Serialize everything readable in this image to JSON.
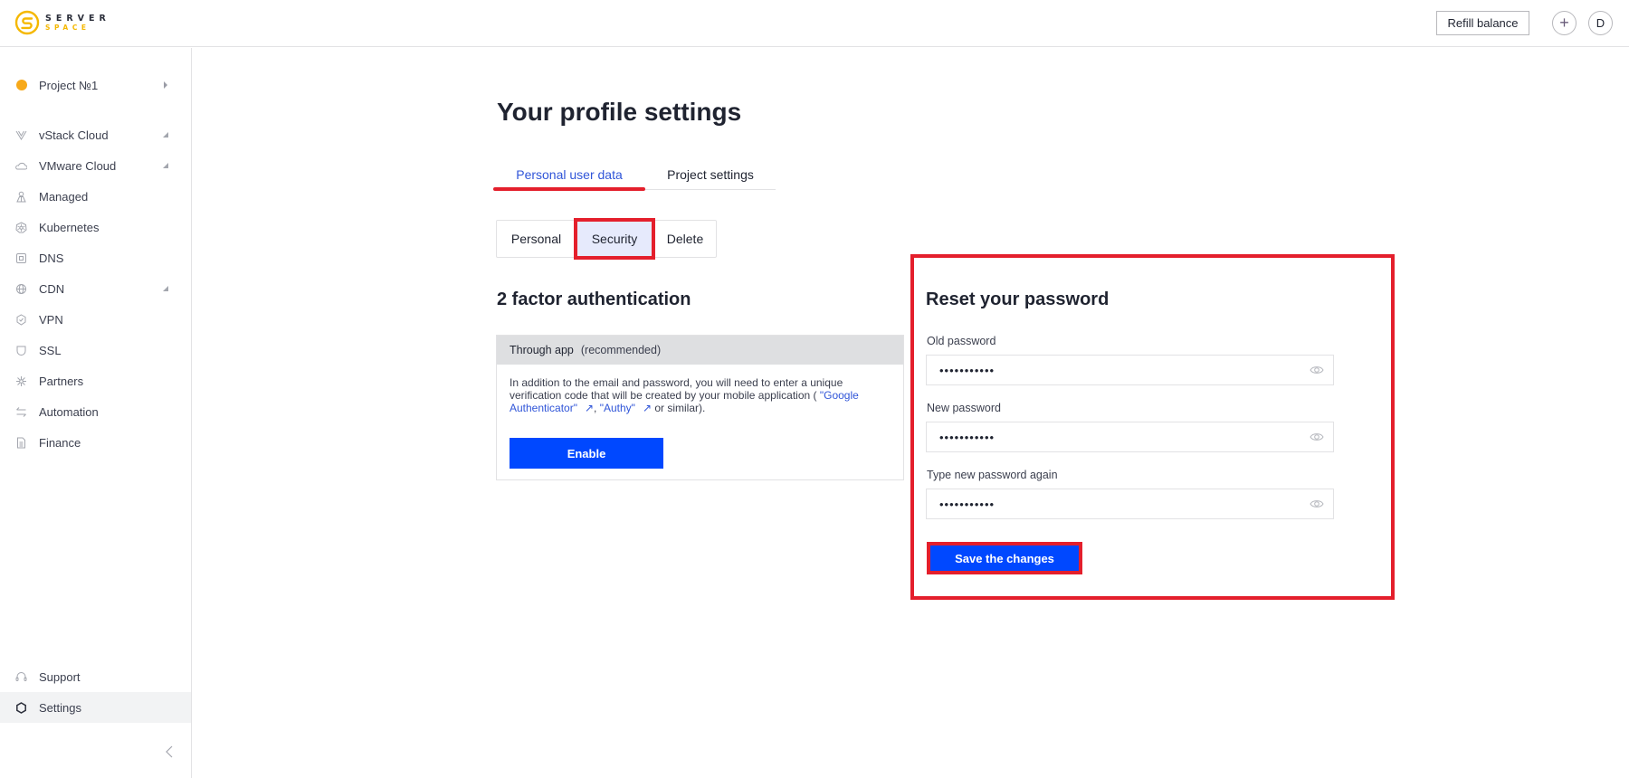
{
  "header": {
    "logo_top": "SERVER",
    "logo_bottom": "SPACE",
    "refill_label": "Refill balance",
    "add_label": "+",
    "avatar_initial": "D"
  },
  "sidebar": {
    "project": {
      "label": "Project №1",
      "icon": "project-dot-icon"
    },
    "items": [
      {
        "label": "vStack Cloud",
        "icon": "vstack-icon",
        "expandable": true
      },
      {
        "label": "VMware Cloud",
        "icon": "cloud-icon",
        "expandable": true
      },
      {
        "label": "Managed",
        "icon": "managed-icon",
        "expandable": false
      },
      {
        "label": "Kubernetes",
        "icon": "kubernetes-icon",
        "expandable": false
      },
      {
        "label": "DNS",
        "icon": "dns-icon",
        "expandable": false
      },
      {
        "label": "CDN",
        "icon": "globe-icon",
        "expandable": true
      },
      {
        "label": "VPN",
        "icon": "vpn-shield-icon",
        "expandable": false
      },
      {
        "label": "SSL",
        "icon": "shield-icon",
        "expandable": false
      },
      {
        "label": "Partners",
        "icon": "partners-icon",
        "expandable": false
      },
      {
        "label": "Automation",
        "icon": "arrows-icon",
        "expandable": false
      },
      {
        "label": "Finance",
        "icon": "document-icon",
        "expandable": false
      }
    ],
    "bottom": [
      {
        "label": "Support",
        "icon": "headset-icon"
      },
      {
        "label": "Settings",
        "icon": "gear-icon",
        "active": true
      }
    ],
    "collapse_icon": "chevron-left-icon"
  },
  "main": {
    "title": "Your profile settings",
    "tabs": [
      {
        "label": "Personal user data",
        "active": true
      },
      {
        "label": "Project settings",
        "active": false
      }
    ],
    "subtabs": [
      {
        "label": "Personal",
        "active": false
      },
      {
        "label": "Security",
        "active": true
      },
      {
        "label": "Delete",
        "active": false
      }
    ],
    "tfa": {
      "title": "2 factor authentication",
      "method": "Through app",
      "method_note": "(recommended)",
      "text_before": "In addition to the email and password, you will need to enter a unique verification code that will be created by your mobile application ( ",
      "link1": "\"Google Authenticator\"",
      "link2": "\"Authy\"",
      "text_after": " or similar).",
      "ext_icon": "↗",
      "separator": ",",
      "enable_label": "Enable"
    },
    "reset": {
      "title": "Reset your password",
      "fields": [
        {
          "label": "Old password",
          "value": "•••••••••••"
        },
        {
          "label": "New password",
          "value": "•••••••••••"
        },
        {
          "label": "Type new password again",
          "value": "•••••••••••"
        }
      ],
      "save_label": "Save the changes"
    }
  },
  "colors": {
    "accent_blue": "#0048ff",
    "link_blue": "#3055d8",
    "highlight_red": "#e41f2c",
    "logo_yellow": "#f5b800"
  }
}
